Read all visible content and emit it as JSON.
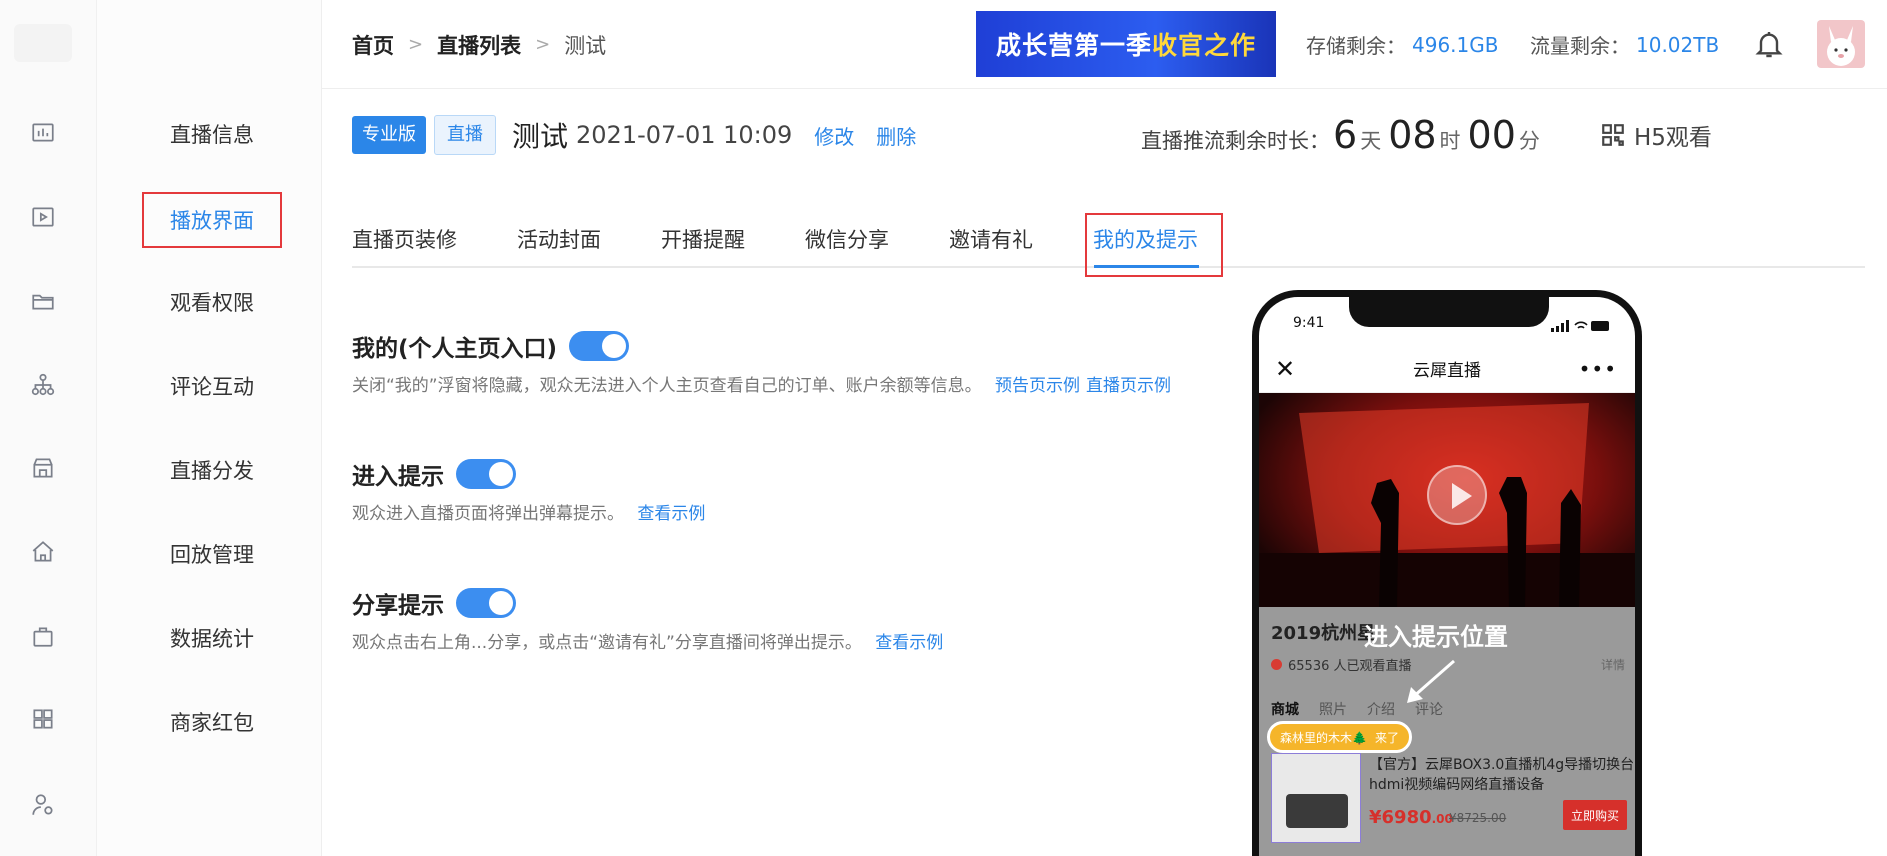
{
  "sidebar_icons": [
    "chart-icon",
    "video-icon",
    "folder-icon",
    "org-icon",
    "store-icon",
    "home-icon",
    "bag-icon",
    "grid-icon",
    "user-settings-icon"
  ],
  "subnav": {
    "items": [
      "直播信息",
      "播放界面",
      "观看权限",
      "评论互动",
      "直播分发",
      "回放管理",
      "数据统计",
      "商家红包"
    ],
    "active": "播放界面"
  },
  "header": {
    "breadcrumb": [
      "首页",
      "直播列表",
      "测试"
    ],
    "banner": {
      "text": "成长营第一季",
      "highlight": "收官之作"
    },
    "storage_label": "存储剩余：",
    "storage_value": "496.1GB",
    "traffic_label": "流量剩余：",
    "traffic_value": "10.02TB"
  },
  "live": {
    "badge_pro": "专业版",
    "badge_live": "直播",
    "title": "测试",
    "time": "2021-07-01 10:09",
    "edit": "修改",
    "delete": "删除",
    "countdown_label": "直播推流剩余时长：",
    "days": "6",
    "days_unit": "天",
    "hours": "08",
    "hours_unit": "时",
    "minutes": "00",
    "minutes_unit": "分",
    "h5": "H5观看"
  },
  "tabs": [
    "直播页装修",
    "活动封面",
    "开播提醒",
    "微信分享",
    "邀请有礼",
    "我的及提示"
  ],
  "active_tab": "我的及提示",
  "settings": [
    {
      "title": "我的(个人主页入口)",
      "enabled": true,
      "desc": "关闭“我的”浮窗将隐藏，观众无法进入个人主页查看自己的订单、账户余额等信息。",
      "links": [
        "预告页示例",
        "直播页示例"
      ]
    },
    {
      "title": "进入提示",
      "enabled": true,
      "desc": "观众进入直播页面将弹出弹幕提示。",
      "links": [
        "查看示例"
      ]
    },
    {
      "title": "分享提示",
      "enabled": true,
      "desc": "观众点击右上角...分享，或点击“邀请有礼”分享直播间将弹出提示。",
      "links": [
        "查看示例"
      ]
    }
  ],
  "preview": {
    "time": "9:41",
    "app_title": "云犀直播",
    "event_title": "2019杭州星",
    "viewers": "65536 人已观看直播",
    "detail": "详情",
    "tabs": [
      "商城",
      "照片",
      "介绍",
      "评论"
    ],
    "hint_label": "进入提示位置",
    "toast_name": "森林里的木木🌲",
    "toast_action": "来了",
    "goods_name": "【官方】云犀BOX3.0直播机4g导播切换台hdmi视频编码网络直播设备",
    "price": "¥6980",
    "price_dec": ".00",
    "old_price": "¥8725.00",
    "buy": "立即购买"
  },
  "colors": {
    "accent": "#2b86e8",
    "highlight_box": "#e4393c",
    "toggle": "#3c8ef0"
  }
}
